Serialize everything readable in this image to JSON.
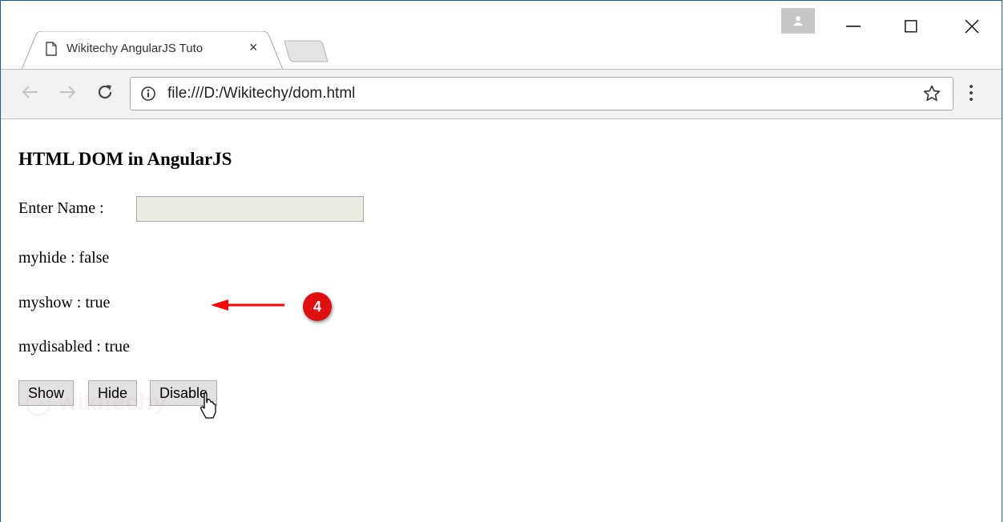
{
  "browser": {
    "tab_title": "Wikitechy AngularJS Tuto",
    "tab_close_glyph": "×",
    "url": "file:///D:/Wikitechy/dom.html",
    "icons": [
      "page-icon",
      "back-icon",
      "forward-icon",
      "reload-icon",
      "info-icon",
      "star-icon",
      "menu-icon",
      "profile-icon",
      "minimize-icon",
      "maximize-icon",
      "close-icon"
    ]
  },
  "page": {
    "heading": "HTML DOM in AngularJS",
    "name_label": "Enter Name :",
    "name_value": "",
    "lines": [
      "myhide : false",
      "myshow : true",
      "mydisabled : true"
    ],
    "buttons": {
      "show": "Show",
      "hide": "Hide",
      "disable": "Disable"
    }
  },
  "annotation": {
    "badge_number": "4",
    "badge_color": "#e01010",
    "arrow_color": "#ff0000"
  }
}
